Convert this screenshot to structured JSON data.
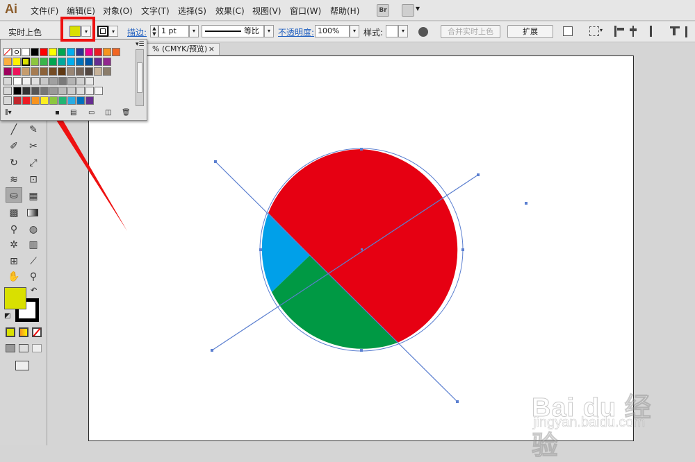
{
  "app": {
    "logo": "Ai"
  },
  "menu": [
    "文件(F)",
    "编辑(E)",
    "对象(O)",
    "文字(T)",
    "选择(S)",
    "效果(C)",
    "视图(V)",
    "窗口(W)",
    "帮助(H)"
  ],
  "menu_extra": {
    "bridge": "Br",
    "workspace_arrow": "▾"
  },
  "control_bar": {
    "mode_label": "实时上色",
    "fill_color": "#d9e000",
    "stroke_label": "描边:",
    "stroke_weight": "1 pt",
    "stroke_style": "等比",
    "opacity_label": "不透明度:",
    "opacity_value": "100%",
    "style_label": "样式:",
    "merge_button": "合并实时上色",
    "expand_button": "扩展"
  },
  "document_tab": {
    "title": "% (CMYK/预览)",
    "close": "×"
  },
  "swatches": {
    "rows": [
      [
        "none",
        "reg",
        "#ffffff",
        "#000000",
        "#ff0000",
        "#ffff00",
        "#00a651",
        "#00aeef",
        "#2e3192",
        "#ec008c",
        "#ed1c24",
        "#f7941d",
        "#f26522"
      ],
      [
        "#fbaf3f",
        "#fff200",
        "#d9e000",
        "#8dc63f",
        "#39b54a",
        "#00a650",
        "#00a99d",
        "#00aeef",
        "#0072bc",
        "#0054a6",
        "#662d91",
        "#92278f"
      ],
      [
        "#9e005d",
        "#ed145b",
        "#c69c6d",
        "#a67c52",
        "#8c6239",
        "#754c24",
        "#603913",
        "#998675",
        "#736357",
        "#534741",
        "#c7b299",
        "#8b7d6b"
      ],
      [
        "#ffffff",
        "#f2f2f2",
        "#e0e0e0",
        "#c8c8c8",
        "#a0a0a0",
        "#7a7a7a",
        "#b3b3b3",
        "#d0d0d0",
        "#e8e8e8"
      ],
      [
        "#000000",
        "#333333",
        "#555555",
        "#777777",
        "#999999",
        "#bbbbbb",
        "#cccccc",
        "#dddddd",
        "#eeeeee",
        "#f5f5f5"
      ],
      [
        "#c1272d",
        "#ed1c24",
        "#f7931e",
        "#fcee21",
        "#8cc63f",
        "#22b573",
        "#29abe2",
        "#0071bc",
        "#662d91"
      ]
    ]
  },
  "tools": {
    "fill_color": "#d9e000",
    "stroke_color": "#000000"
  },
  "artwork": {
    "circle_fills": {
      "red": "#e60012",
      "blue": "#00a0e9",
      "green": "#009944"
    },
    "path_color": "#5b7fd0"
  },
  "watermark": {
    "brand": "Bai du 经验",
    "url": "jingyan.baidu.com"
  }
}
